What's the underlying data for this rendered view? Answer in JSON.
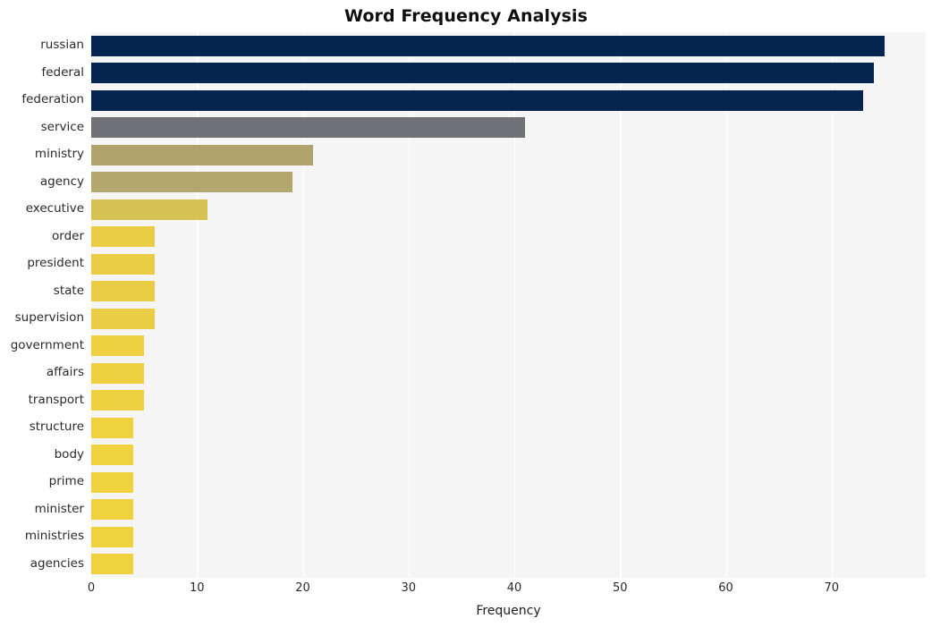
{
  "chart_data": {
    "type": "bar",
    "orientation": "horizontal",
    "title": "Word Frequency Analysis",
    "xlabel": "Frequency",
    "ylabel": "",
    "xlim": [
      0,
      78.9
    ],
    "xticks": [
      0,
      10,
      20,
      30,
      40,
      50,
      60,
      70
    ],
    "xtick_labels": [
      "0",
      "10",
      "20",
      "30",
      "40",
      "50",
      "60",
      "70"
    ],
    "grid": "vertical-white",
    "legend": "none",
    "categories": [
      "russian",
      "federal",
      "federation",
      "service",
      "ministry",
      "agency",
      "executive",
      "order",
      "president",
      "state",
      "supervision",
      "government",
      "affairs",
      "transport",
      "structure",
      "body",
      "prime",
      "minister",
      "ministries",
      "agencies"
    ],
    "values": [
      75,
      74,
      73,
      41,
      21,
      19,
      11,
      6,
      6,
      6,
      6,
      5,
      5,
      5,
      4,
      4,
      4,
      4,
      4,
      4
    ],
    "bar_colors": [
      "#052450",
      "#052450",
      "#052450",
      "#707176",
      "#b0a46c",
      "#b3a76d",
      "#d6c254",
      "#ebcc45",
      "#ebcc45",
      "#ebcc45",
      "#ebcc45",
      "#efd040",
      "#efd040",
      "#efd040",
      "#f0d23f",
      "#f0d23f",
      "#f0d23f",
      "#f0d23f",
      "#f0d23f",
      "#f0d23f"
    ],
    "plot_background": "#f5f5f5",
    "figure_background": "#ffffff",
    "gridline_color": "#ffffff"
  }
}
